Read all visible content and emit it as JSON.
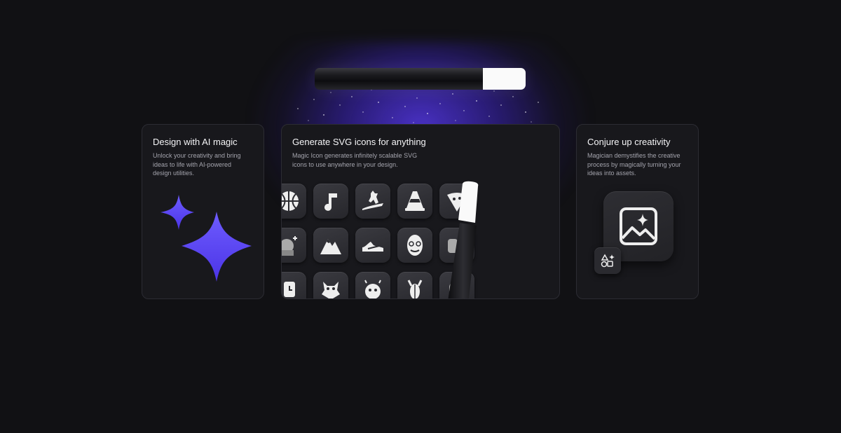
{
  "hero": {
    "wand_icon": "magic-wand-icon",
    "accent": "#5b45ff"
  },
  "cards": [
    {
      "title": "Design with AI magic",
      "description": "Unlock your creativity and bring ideas to life with AI-powered design utilities.",
      "illustration_icon": "sparkles-icon"
    },
    {
      "title": "Generate SVG icons for anything",
      "description": "Magic Icon generates infinitely scalable SVG icons to use anywhere in your design.",
      "icons": [
        "basketball-icon",
        "music-note-icon",
        "surfing-dog-icon",
        "traffic-cone-icon",
        "pizza-icon",
        "wizard-icon",
        "mountains-icon",
        "sneaker-icon",
        "ringo-face-icon",
        "game-controller-icon",
        "clock-icon",
        "dragon-icon",
        "fortune-teller-icon",
        "lobster-icon",
        "ghost-icon"
      ]
    },
    {
      "title": "Conjure up creativity",
      "description": "Magician demystifies the creative process by magically turning your ideas into assets.",
      "illustration_icon": "image-sparkle-icon",
      "badge_icon": "shapes-sparkle-icon"
    }
  ]
}
